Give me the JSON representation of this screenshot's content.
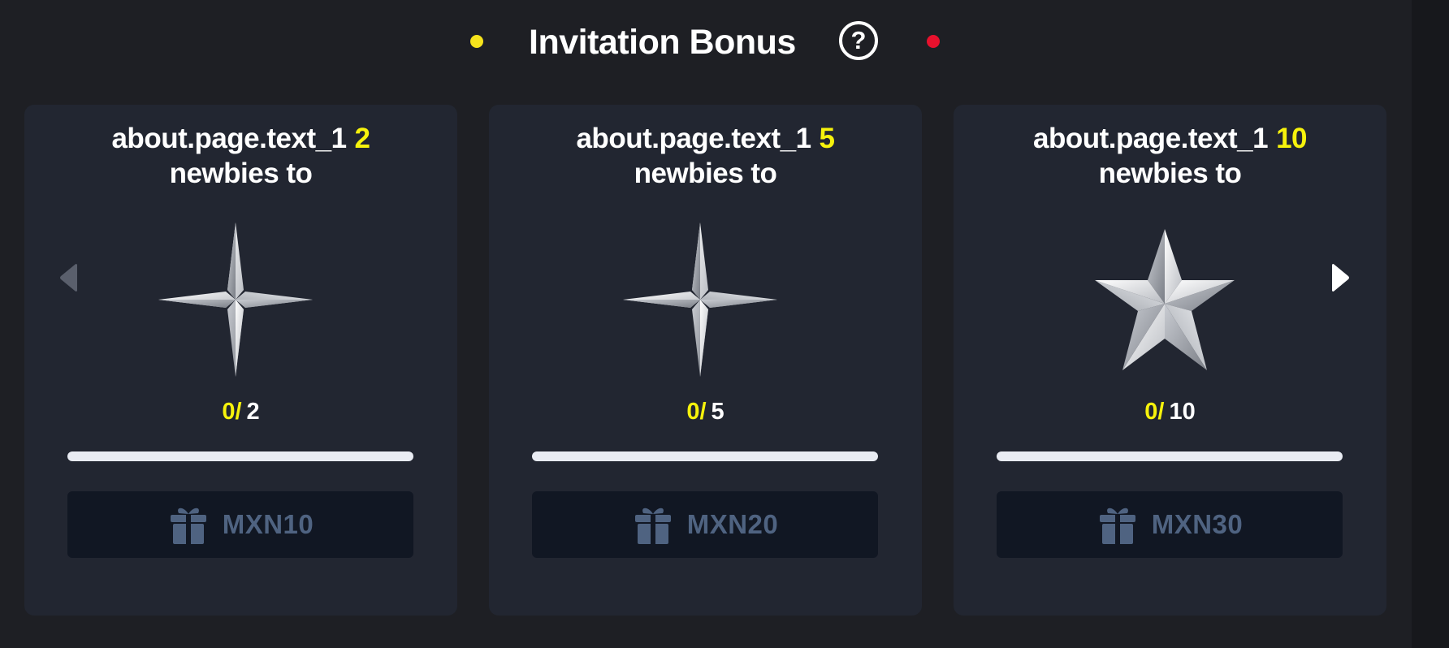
{
  "header": {
    "title": "Invitation Bonus",
    "help_symbol": "?",
    "indicator_colors": {
      "active": "#f6e31c",
      "inactive": "#e8112d"
    }
  },
  "colors": {
    "background": "#1e1f24",
    "card": "#222631",
    "highlight": "#f6f20c",
    "claim_button": "#111723",
    "claim_text": "#4f6381"
  },
  "navigation": {
    "prev_icon": "chevron-left-icon",
    "next_icon": "chevron-right-icon"
  },
  "tiers": [
    {
      "title": "about.page.text_1",
      "target": "2",
      "subtitle": "newbies to",
      "icon": "four-point-star-icon",
      "current": "0",
      "separator": "/",
      "total": "2",
      "progress": 0,
      "reward_icon": "gift-icon",
      "reward": "MXN10"
    },
    {
      "title": "about.page.text_1",
      "target": "5",
      "subtitle": "newbies to",
      "icon": "four-point-star-icon",
      "current": "0",
      "separator": "/",
      "total": "5",
      "progress": 0,
      "reward_icon": "gift-icon",
      "reward": "MXN20"
    },
    {
      "title": "about.page.text_1",
      "target": "10",
      "subtitle": "newbies to",
      "icon": "five-point-star-icon",
      "current": "0",
      "separator": "/",
      "total": "10",
      "progress": 0,
      "reward_icon": "gift-icon",
      "reward": "MXN30"
    }
  ]
}
